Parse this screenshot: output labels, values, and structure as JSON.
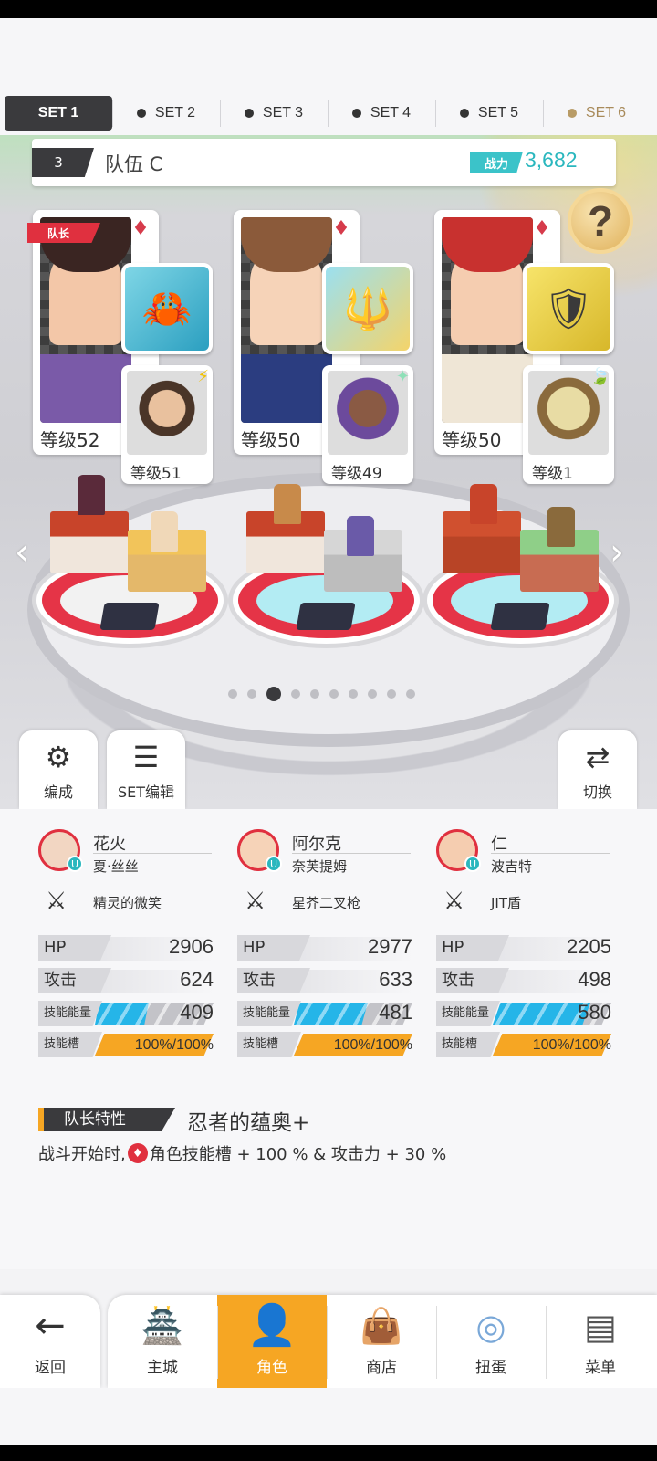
{
  "set_tabs": [
    {
      "label": "SET 1",
      "active": true
    },
    {
      "label": "SET 2",
      "active": false
    },
    {
      "label": "SET 3",
      "active": false
    },
    {
      "label": "SET 4",
      "active": false
    },
    {
      "label": "SET 5",
      "active": false
    },
    {
      "label": "SET 6",
      "active": false
    }
  ],
  "team": {
    "number": "3",
    "name": "队伍 C",
    "power_label": "战力",
    "power_value": "3,682"
  },
  "help_icon": "?",
  "leader_flag": "队长",
  "cards": [
    {
      "level": "等级52",
      "sub_level": "等级51",
      "weapon_icon": "crab-pot-icon",
      "sub_mark": "⚡"
    },
    {
      "level": "等级50",
      "sub_level": "等级49",
      "weapon_icon": "trident-icon",
      "sub_mark": "✦"
    },
    {
      "level": "等级50",
      "sub_level": "等级1",
      "weapon_icon": "shield-icon",
      "sub_mark": "🍃"
    }
  ],
  "page_indicator": {
    "count": 10,
    "active_index": 2
  },
  "buttons": {
    "formation": "编成",
    "set_edit": "SET编辑",
    "switch": "切换"
  },
  "characters": [
    {
      "name": "花火",
      "sub": "夏·丝丝",
      "weapon": "精灵的微笑",
      "hp_label": "HP",
      "hp": "2906",
      "atk_label": "攻击",
      "atk": "624",
      "energy_label": "技能能量",
      "energy": "409",
      "energy_fill": 0.45,
      "slot_label": "技能槽",
      "slot": "100%/100%",
      "slot_fill": 1.0
    },
    {
      "name": "阿尔克",
      "sub": "奈芙提姆",
      "weapon": "星芥二叉枪",
      "hp_label": "HP",
      "hp": "2977",
      "atk_label": "攻击",
      "atk": "633",
      "energy_label": "技能能量",
      "energy": "481",
      "energy_fill": 0.62,
      "slot_label": "技能槽",
      "slot": "100%/100%",
      "slot_fill": 1.0
    },
    {
      "name": "仁",
      "sub": "波吉特",
      "weapon": "JIT盾",
      "hp_label": "HP",
      "hp": "2205",
      "atk_label": "攻击",
      "atk": "498",
      "energy_label": "技能能量",
      "energy": "580",
      "energy_fill": 0.82,
      "slot_label": "技能槽",
      "slot": "100%/100%",
      "slot_fill": 1.0
    }
  ],
  "leader_trait": {
    "label": "队长特性",
    "name": "忍者的蕴奥+",
    "desc_prefix": "战斗开始时,",
    "desc_suffix": "角色技能槽 + 100 % & 攻击力 + 30 %"
  },
  "nav": {
    "back": "返回",
    "items": [
      {
        "label": "主城",
        "icon": "castle-icon",
        "active": false
      },
      {
        "label": "角色",
        "icon": "character-icon",
        "active": true
      },
      {
        "label": "商店",
        "icon": "shop-icon",
        "active": false
      },
      {
        "label": "扭蛋",
        "icon": "gacha-icon",
        "active": false
      },
      {
        "label": "菜单",
        "icon": "menu-icon",
        "active": false
      }
    ]
  },
  "colors": {
    "accent_orange": "#f6a623",
    "accent_cyan": "#2ab7be",
    "leader_red": "#e0303f"
  }
}
